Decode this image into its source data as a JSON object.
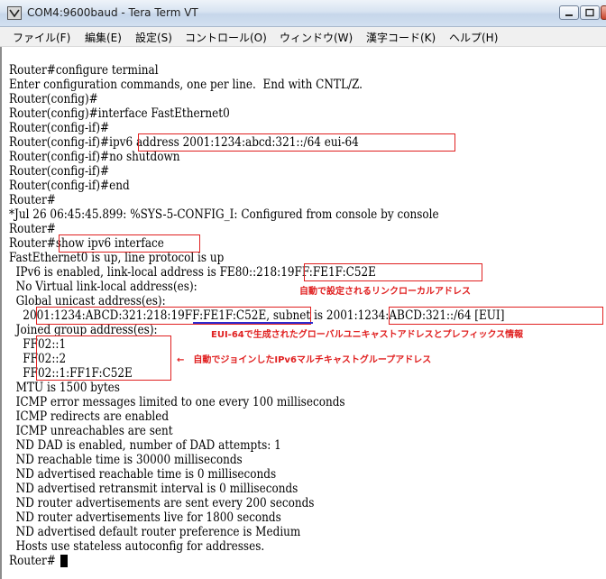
{
  "window": {
    "title": "COM4:9600baud - Tera Term VT"
  },
  "menu": {
    "items": [
      "ファイル(F)",
      "編集(E)",
      "設定(S)",
      "コントロール(O)",
      "ウィンドウ(W)",
      "漢字コード(K)",
      "ヘルプ(H)"
    ]
  },
  "terminal": {
    "lines": [
      "Router#configure terminal",
      "Enter configuration commands, one per line.  End with CNTL/Z.",
      "Router(config)#",
      "Router(config)#interface FastEthernet0",
      "Router(config-if)#",
      "Router(config-if)#ipv6 address 2001:1234:abcd:321::/64 eui-64",
      "Router(config-if)#no shutdown",
      "Router(config-if)#",
      "Router(config-if)#end",
      "Router#",
      "*Jul 26 06:45:45.899: %SYS-5-CONFIG_I: Configured from console by console",
      "Router#",
      "Router#show ipv6 interface",
      "FastEthernet0 is up, line protocol is up",
      "  IPv6 is enabled, link-local address is FE80::218:19FF:FE1F:C52E",
      "  No Virtual link-local address(es):",
      "  Global unicast address(es):",
      "    2001:1234:ABCD:321:218:19FF:FE1F:C52E, subnet is 2001:1234:ABCD:321::/64 [EUI]",
      "  Joined group address(es):",
      "    FF02::1",
      "    FF02::2",
      "    FF02::1:FF1F:C52E",
      "  MTU is 1500 bytes",
      "  ICMP error messages limited to one every 100 milliseconds",
      "  ICMP redirects are enabled",
      "  ICMP unreachables are sent",
      "  ND DAD is enabled, number of DAD attempts: 1",
      "  ND reachable time is 30000 milliseconds",
      "  ND advertised reachable time is 0 milliseconds",
      "  ND advertised retransmit interval is 0 milliseconds",
      "  ND router advertisements are sent every 200 seconds",
      "  ND router advertisements live for 1800 seconds",
      "  ND advertised default router preference is Medium",
      "  Hosts use stateless autoconfig for addresses.",
      "Router#"
    ]
  },
  "annotations": {
    "link_local_note": "自動で設定されるリンクローカルアドレス",
    "global_note": "EUI-64で生成されたグローバルユニキャストアドレスとプレフィックス情報",
    "multicast_note": "←　自動でジョインしたIPv6マルチキャストグループアドレス"
  },
  "colors": {
    "highlight": "#e02020",
    "underline": "#2b2bd0",
    "terminal_bg": "#ffffff",
    "terminal_fg": "#000000"
  }
}
